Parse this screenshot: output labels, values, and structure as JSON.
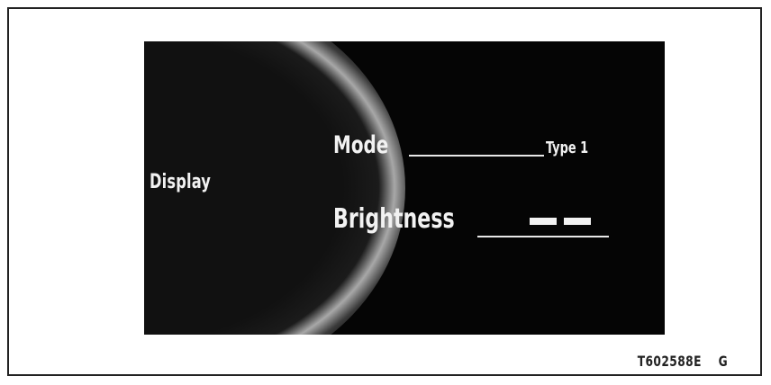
{
  "screen": {
    "dial_label": "Display",
    "menu": [
      {
        "label": "Mode",
        "value": "Type 1"
      },
      {
        "label": "Brightness",
        "level_bars": 2
      }
    ]
  },
  "figure": {
    "code": "T602588E",
    "suffix": "G"
  }
}
